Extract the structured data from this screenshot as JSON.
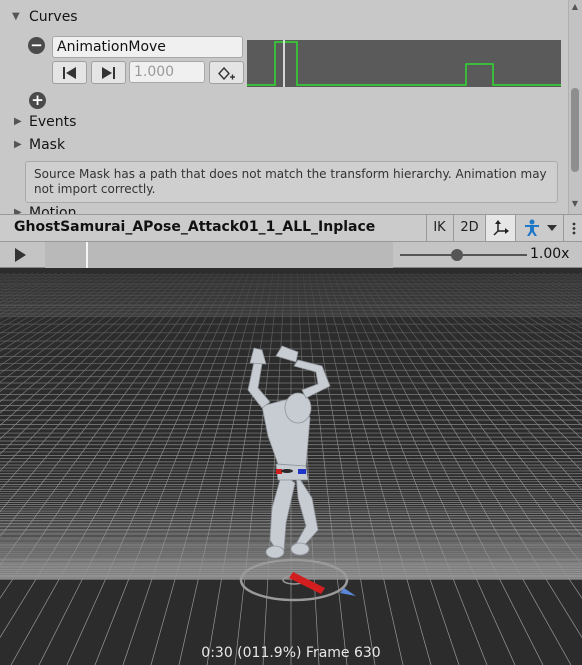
{
  "curves": {
    "label": "Curves",
    "curve_name": "AnimationMove",
    "value_placeholder": "1.000"
  },
  "sections": {
    "events": "Events",
    "mask": "Mask",
    "motion": "Motion"
  },
  "help": {
    "message": "Source Mask has a path that does not match the transform hierarchy. Animation may not import correctly."
  },
  "preview": {
    "title": "GhostSamurai_APose_Attack01_1_ALL_Inplace",
    "ik_label": "IK",
    "mode_2d_label": "2D",
    "speed_label": "1.00x",
    "speed_fraction": 0.45,
    "status": "0:30 (011.9%) Frame 630"
  },
  "icons": {
    "collapse": "collapse-triangle-icon",
    "remove": "minus-circle-icon",
    "add": "plus-circle-icon",
    "prev_key": "previous-key-icon",
    "next_key": "next-key-icon",
    "add_key": "add-keyframe-icon",
    "pivot": "pivot-axes-icon",
    "avatar": "avatar-figure-icon",
    "dropdown": "dropdown-arrow-icon",
    "more": "more-vertical-icon",
    "play": "play-icon"
  },
  "colors": {
    "curve_line": "#2fdc2f",
    "accent_blue": "#1e78c8",
    "viewport_bg": "#2c2c2c",
    "grid_line": "#bfbfbf"
  }
}
